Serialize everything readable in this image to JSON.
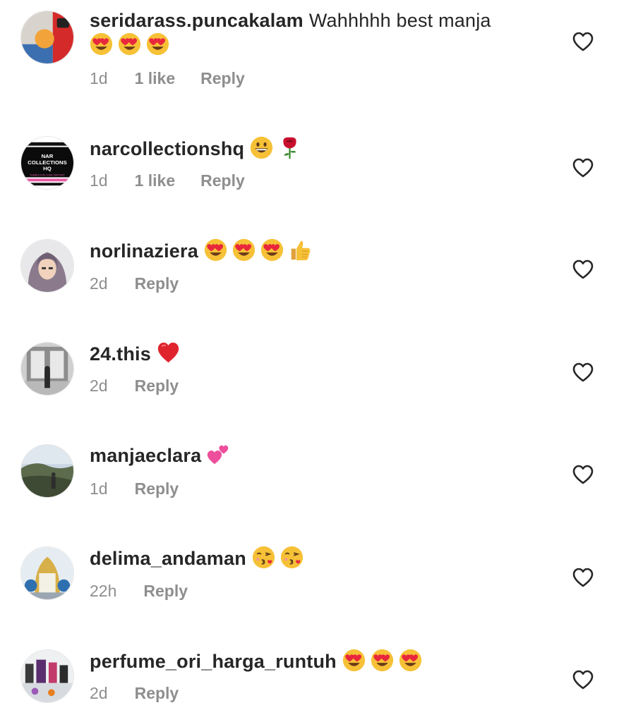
{
  "comments": [
    {
      "username": "seridarass.puncakalam",
      "text": "Wahhhhh best manja",
      "emojis": [
        "heart-eyes",
        "heart-eyes",
        "heart-eyes"
      ],
      "time": "1d",
      "likes": "1 like",
      "reply": "Reply"
    },
    {
      "username": "narcollectionshq",
      "text": "",
      "emojis": [
        "grinning",
        "rose"
      ],
      "time": "1d",
      "likes": "1 like",
      "reply": "Reply",
      "avatar_text": [
        "NAR",
        "COLLECTIONS",
        "HQ",
        "THANKS FOR YOUR SUPPORT"
      ]
    },
    {
      "username": "norlinaziera",
      "text": "",
      "emojis": [
        "heart-eyes",
        "heart-eyes",
        "heart-eyes",
        "thumbs-up"
      ],
      "time": "2d",
      "reply": "Reply"
    },
    {
      "username": "24.this",
      "text": "",
      "emojis": [
        "red-heart"
      ],
      "time": "2d",
      "reply": "Reply"
    },
    {
      "username": "manjaeclara",
      "text": "",
      "emojis": [
        "two-hearts"
      ],
      "time": "1d",
      "reply": "Reply"
    },
    {
      "username": "delima_andaman",
      "text": "",
      "emojis": [
        "kissing-heart",
        "kissing-heart"
      ],
      "time": "22h",
      "reply": "Reply"
    },
    {
      "username": "perfume_ori_harga_runtuh",
      "text": "",
      "emojis": [
        "heart-eyes",
        "heart-eyes",
        "heart-eyes"
      ],
      "time": "2d",
      "reply": "Reply"
    }
  ],
  "colors": {
    "text": "#262626",
    "meta": "#8e8e8e",
    "heart_outline": "#262626"
  }
}
